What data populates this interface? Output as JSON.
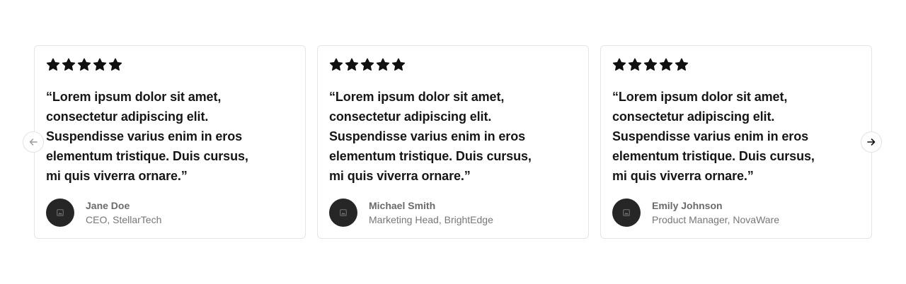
{
  "testimonials": [
    {
      "rating": 5,
      "quote": "“Lorem ipsum dolor sit amet, consectetur adipiscing elit. Suspendisse varius enim in eros elementum tristique. Duis cursus, mi quis viverra ornare.”",
      "name": "Jane Doe",
      "role": "CEO, StellarTech",
      "avatar_icon": "image-placeholder-icon"
    },
    {
      "rating": 5,
      "quote": "“Lorem ipsum dolor sit amet, consectetur adipiscing elit. Suspendisse varius enim in eros elementum tristique. Duis cursus, mi quis viverra ornare.”",
      "name": "Michael Smith",
      "role": "Marketing Head, BrightEdge",
      "avatar_icon": "image-placeholder-icon"
    },
    {
      "rating": 5,
      "quote": "“Lorem ipsum dolor sit amet, consectetur adipiscing elit. Suspendisse varius enim in eros elementum tristique. Duis cursus, mi quis viverra ornare.”",
      "name": "Emily Johnson",
      "role": "Product Manager, NovaWare",
      "avatar_icon": "image-placeholder-icon"
    }
  ],
  "nav": {
    "prev_icon": "arrow-left-icon",
    "next_icon": "arrow-right-icon"
  },
  "colors": {
    "star": "#111111",
    "avatar_bg": "#262626",
    "card_border": "#e4e4e4",
    "name_text": "#6b6b6b",
    "role_text": "#777777"
  }
}
